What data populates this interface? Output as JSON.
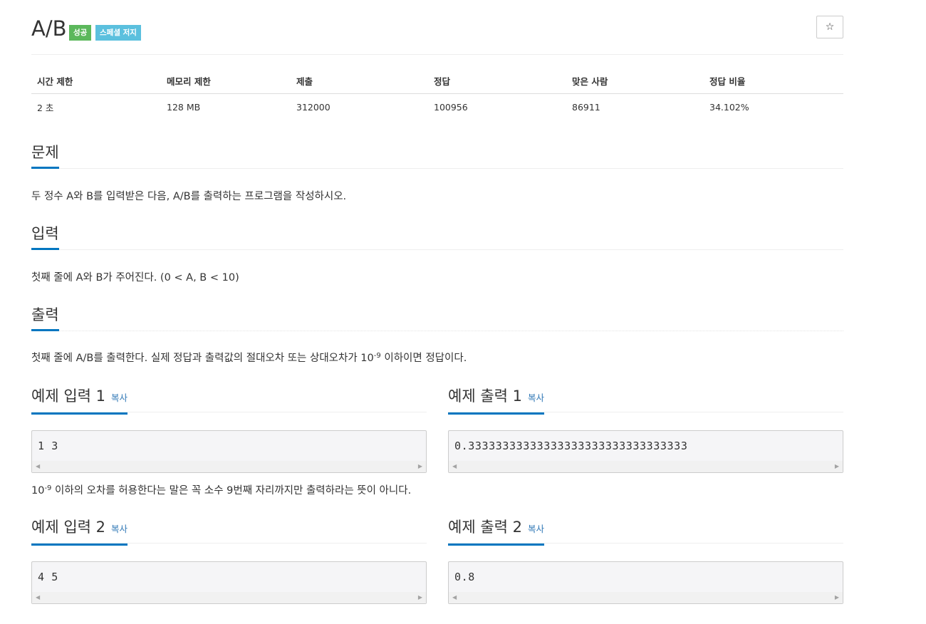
{
  "problem": {
    "title": "A/B",
    "badges": {
      "success": "성공",
      "special_judge": "스페셜 저지"
    },
    "star_icon": "☆"
  },
  "info_table": {
    "headers": [
      "시간 제한",
      "메모리 제한",
      "제출",
      "정답",
      "맞은 사람",
      "정답 비율"
    ],
    "values": [
      "2 초",
      "128 MB",
      "312000",
      "100956",
      "86911",
      "34.102%"
    ]
  },
  "sections": {
    "problem": {
      "title": "문제",
      "text": "두 정수 A와 B를 입력받은 다음, A/B를 출력하는 프로그램을 작성하시오."
    },
    "input": {
      "title": "입력",
      "text": "첫째 줄에 A와 B가 주어진다. (0 < A, B < 10)"
    },
    "output": {
      "title": "출력",
      "text_before": "첫째 줄에 A/B를 출력한다. 실제 정답과 출력값의 절대오차 또는 상대오차가 10",
      "exponent": "-9",
      "text_after": " 이하이면 정답이다."
    }
  },
  "copy_label": "복사",
  "samples": [
    {
      "input_title": "예제 입력 1",
      "input": "1 3",
      "output_title": "예제 출력 1",
      "output": "0.33333333333333333333333333333333"
    },
    {
      "input_title": "예제 입력 2",
      "input": "4 5",
      "output_title": "예제 출력 2",
      "output": "0.8"
    }
  ],
  "hint": {
    "base": "10",
    "exponent": "-9",
    "text": " 이하의 오차를 허용한다는 말은 꼭 소수 9번째 자리까지만 출력하라는 뜻이 아니다."
  }
}
